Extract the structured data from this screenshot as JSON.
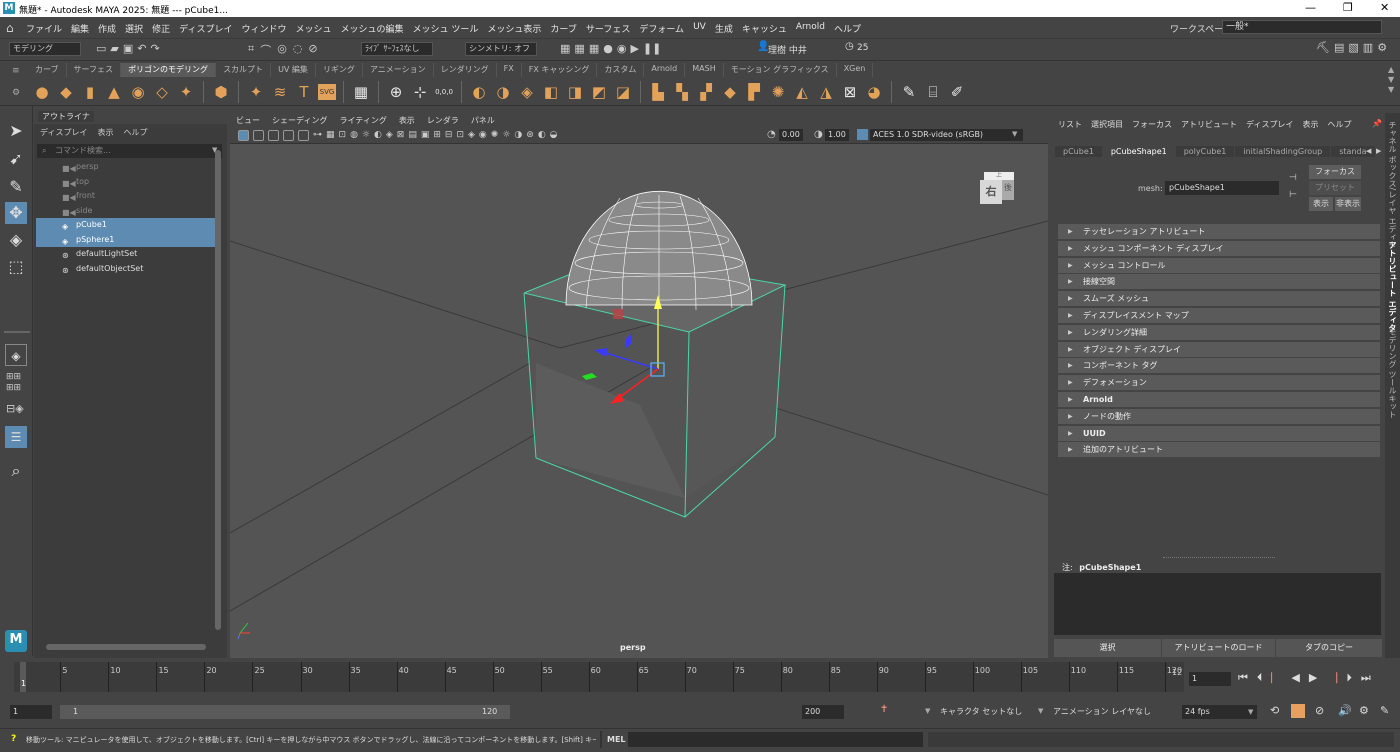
{
  "window": {
    "title": "無題* - Autodesk MAYA 2025: 無題 --- pCube1...",
    "controls": [
      "—",
      "❐",
      "✕"
    ]
  },
  "menubar": {
    "items": [
      "ファイル",
      "編集",
      "作成",
      "選択",
      "修正",
      "ディスプレイ",
      "ウィンドウ",
      "メッシュ",
      "メッシュの編集",
      "メッシュ ツール",
      "メッシュ表示",
      "カーブ",
      "サーフェス",
      "デフォーム",
      "UV",
      "生成",
      "キャッシュ",
      "Arnold",
      "ヘルプ"
    ],
    "workspace_label": "ワークスペース:",
    "workspace_value": "一般*"
  },
  "statusline": {
    "mode": "モデリング",
    "live": "ﾗｲﾌﾞ ｻｰﾌｪｽなし",
    "symmetry": "シンメトリ: オフ",
    "user": "理樹 中井",
    "count": "25"
  },
  "shelf": {
    "tabs": [
      "カーブ",
      "サーフェス",
      "ポリゴンのモデリング",
      "スカルプト",
      "UV 編集",
      "リギング",
      "アニメーション",
      "レンダリング",
      "FX",
      "FX キャッシング",
      "カスタム",
      "Arnold",
      "MASH",
      "モーション グラフィックス",
      "XGen"
    ],
    "selected_tab": "ポリゴンのモデリング",
    "text_icons": {
      "text_tool": "T",
      "svg_tool": "SVG",
      "coords": "0,0,0"
    }
  },
  "outliner": {
    "tab": "アウトライナ",
    "menu": [
      "ディスプレイ",
      "表示",
      "ヘルプ"
    ],
    "search_placeholder": "コマンド検索...",
    "items": [
      {
        "label": "persp",
        "icon": "camera-icon",
        "dim": true
      },
      {
        "label": "top",
        "icon": "camera-icon",
        "dim": true
      },
      {
        "label": "front",
        "icon": "camera-icon",
        "dim": true
      },
      {
        "label": "side",
        "icon": "camera-icon",
        "dim": true
      },
      {
        "label": "pCube1",
        "icon": "mesh-icon",
        "selected": true
      },
      {
        "label": "pSphere1",
        "icon": "mesh-icon",
        "selected": true
      },
      {
        "label": "defaultLightSet",
        "icon": "set-icon"
      },
      {
        "label": "defaultObjectSet",
        "icon": "set-icon"
      }
    ]
  },
  "viewport": {
    "menu": [
      "ビュー",
      "シェーディング",
      "ライティング",
      "表示",
      "レンダラ",
      "パネル"
    ],
    "exposure": "0.00",
    "gamma": "1.00",
    "colorspace": "ACES 1.0 SDR-video (sRGB)",
    "camera_label": "persp",
    "viewcube": {
      "face_right": "右",
      "face_back": "後",
      "face_top": "上"
    }
  },
  "attribute_editor": {
    "menu": [
      "リスト",
      "選択項目",
      "フォーカス",
      "アトリビュート",
      "ディスプレイ",
      "表示",
      "ヘルプ"
    ],
    "tabs": [
      "pCube1",
      "pCubeShape1",
      "polyCube1",
      "initialShadingGroup",
      "standa"
    ],
    "selected_tab": "pCubeShape1",
    "mesh_label": "mesh:",
    "mesh_value": "pCubeShape1",
    "buttons": {
      "focus": "フォーカス",
      "preset": "プリセット",
      "show": "表示",
      "hide": "非表示"
    },
    "sections": [
      "テッセレーション アトリビュート",
      "メッシュ コンポーネント ディスプレイ",
      "メッシュ コントロール",
      "接線空間",
      "スムーズ メッシュ",
      "ディスプレイスメント マップ",
      "レンダリング詳細",
      "オブジェクト ディスプレイ",
      "コンポーネント タグ",
      "デフォメーション",
      "Arnold",
      "ノードの動作",
      "UUID",
      "追加のアトリビュート"
    ],
    "note_label": "注:",
    "note_value": "pCubeShape1",
    "bottom_buttons": [
      "選択",
      "アトリビュートのロード",
      "タブのコピー"
    ]
  },
  "side_tabs": [
    "チャネル ボックス/レイヤ エディタ",
    "アトリビュート エディタ",
    "モデリング ツールキット"
  ],
  "timeline": {
    "ticks": [
      "5",
      "10",
      "15",
      "20",
      "25",
      "30",
      "35",
      "40",
      "45",
      "50",
      "55",
      "60",
      "65",
      "70",
      "75",
      "80",
      "85",
      "90",
      "95",
      "100",
      "105",
      "110",
      "115",
      "120"
    ],
    "start_marker": "1",
    "end_marker": "12",
    "current_frame": "1",
    "current_frame_field": "1"
  },
  "range": {
    "start": "1",
    "inner_start": "1",
    "inner_end": "120",
    "end": "200",
    "character_set": "キャラクタ セットなし",
    "anim_layer": "アニメーション レイヤなし",
    "fps": "24 fps"
  },
  "command": {
    "help_text": "移動ツール: マニピュレータを使用して、オブジェクトを移動します。[Ctrl] キーを押しながら中マウス ボタンでドラッグし、法線に沿ってコンポーネントを移動します。[Shift] キーを押しながらマニピ",
    "mel_label": "MEL"
  }
}
